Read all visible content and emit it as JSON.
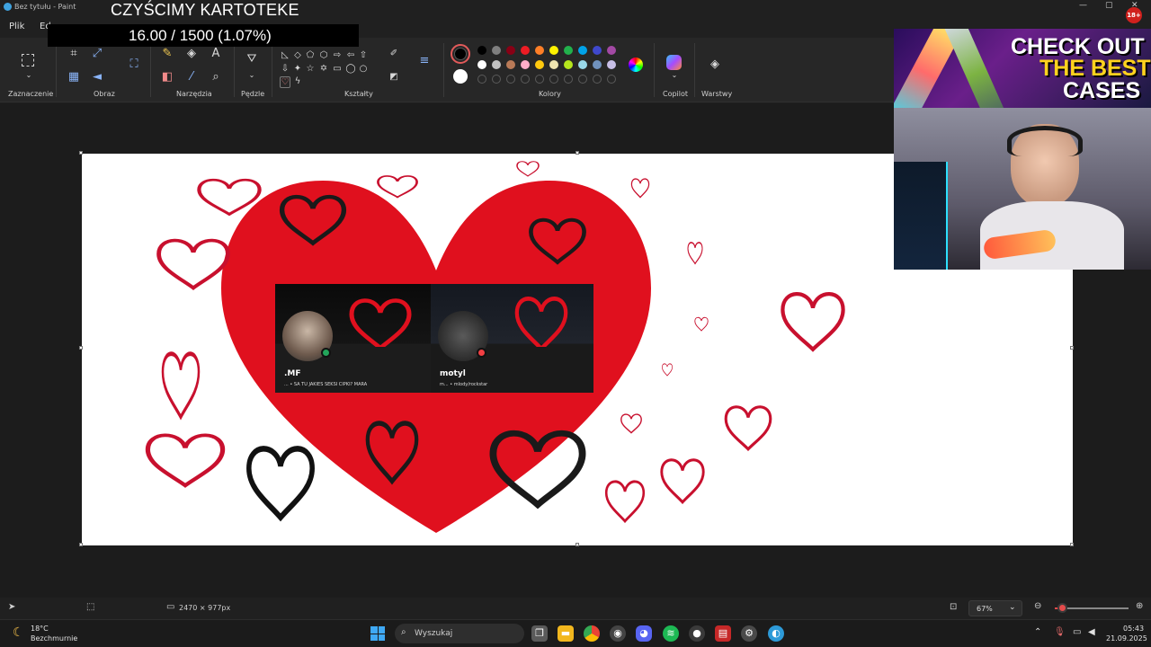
{
  "window": {
    "title": "Bez tytułu - Paint",
    "minimize": "—",
    "maximize": "▢",
    "close": "✕"
  },
  "menu": {
    "items": [
      "Plik",
      "Ed"
    ]
  },
  "overlay": {
    "stream_title": "CZYŚCIMY KARTOTEKE",
    "counter": "16.00 / 1500 (1.07%)"
  },
  "ribbon": {
    "groups": [
      "Zaznaczenie",
      "Obraz",
      "Narzędzia",
      "Pędzle",
      "Kształty",
      "Kolory",
      "Copilot",
      "Warstwy"
    ]
  },
  "colors": {
    "primary": "#000000",
    "secondary": "#ffffff",
    "row1": [
      "#000000",
      "#7f7f7f",
      "#880015",
      "#ed1c24",
      "#ff7f27",
      "#fff200",
      "#22b14c",
      "#00a2e8",
      "#3f48cc",
      "#a349a4"
    ],
    "row2": [
      "#ffffff",
      "#c3c3c3",
      "#b97a57",
      "#ffaec9",
      "#ffc90e",
      "#efe4b0",
      "#b5e61d",
      "#99d9ea",
      "#7092be",
      "#c8bfe7"
    ],
    "heart_fill": "#e0101e",
    "heart_outline": "#c8102e"
  },
  "cards": [
    {
      "name": ".MF",
      "status": "... • SA TU JAKIES SEKSI CIPKI?   MARA"
    },
    {
      "name": "motyl",
      "status": "m... • mlody/rockstar"
    }
  ],
  "ad": {
    "line1": "CHECK OUT",
    "line2": "THE BEST",
    "line3": "CASES",
    "badge": "18+"
  },
  "statusbar": {
    "dimensions": "2470 × 977px",
    "zoom": "67%",
    "zoom_level": 0.1
  },
  "taskbar": {
    "weather_temp": "18°C",
    "weather_desc": "Bezchmurnie",
    "search_placeholder": "Wyszukaj",
    "time": "05:43",
    "date": "21.09.2025"
  }
}
